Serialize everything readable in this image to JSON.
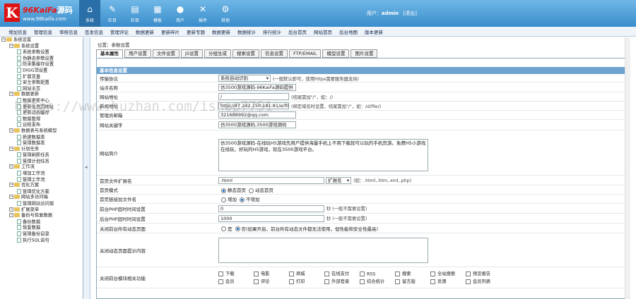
{
  "brand": {
    "logo_letter": "K",
    "name": "96KaiFa",
    "name_suffix": "源码",
    "url": "www.96kaifa.com"
  },
  "nav": [
    {
      "label": "系统",
      "icon": "home-icon"
    },
    {
      "label": "栏目",
      "icon": "document-edit-icon"
    },
    {
      "label": "栏目",
      "icon": "document-icon"
    },
    {
      "label": "模板",
      "icon": "template-icon"
    },
    {
      "label": "用户",
      "icon": "user-icon"
    },
    {
      "label": "插件",
      "icon": "tools-icon"
    },
    {
      "label": "其他",
      "icon": "gear-icon"
    }
  ],
  "user": {
    "prefix": "用户：",
    "name": "admin",
    "logout": "[退出]"
  },
  "menu": [
    "增加信息",
    "管理信息",
    "审核信息",
    "签发信息",
    "管理评论",
    "数据更新",
    "更新碎片",
    "更新专题",
    "数据更新",
    "数据统计",
    "排行统计",
    "后台首页",
    "网站首页",
    "后台地图",
    "版本更新"
  ],
  "tree": [
    {
      "t": "系统设置",
      "lvl": 0,
      "kind": "root"
    },
    {
      "t": "系统设置",
      "lvl": 1,
      "kind": "folder"
    },
    {
      "t": "系统参数设置",
      "lvl": 2,
      "kind": "doc"
    },
    {
      "t": "伪静态参数设置",
      "lvl": 2,
      "kind": "doc"
    },
    {
      "t": "防采集缓存设置",
      "lvl": 2,
      "kind": "doc"
    },
    {
      "t": "DIGG顶设置",
      "lvl": 2,
      "kind": "doc"
    },
    {
      "t": "扩展变量",
      "lvl": 2,
      "kind": "doc"
    },
    {
      "t": "安全参数配置",
      "lvl": 2,
      "kind": "doc"
    },
    {
      "t": "网站主页",
      "lvl": 2,
      "kind": "doc"
    },
    {
      "t": "数据更新",
      "lvl": 1,
      "kind": "folder"
    },
    {
      "t": "数据更新中心",
      "lvl": 2,
      "kind": "doc"
    },
    {
      "t": "更新信息页地址",
      "lvl": 2,
      "kind": "doc"
    },
    {
      "t": "更新动态缓存",
      "lvl": 2,
      "kind": "doc"
    },
    {
      "t": "数据整理",
      "lvl": 2,
      "kind": "doc"
    },
    {
      "t": "远程发布",
      "lvl": 2,
      "kind": "doc"
    },
    {
      "t": "数据表与系统模型",
      "lvl": 1,
      "kind": "folder"
    },
    {
      "t": "新建数据表",
      "lvl": 2,
      "kind": "doc"
    },
    {
      "t": "管理数据表",
      "lvl": 2,
      "kind": "doc"
    },
    {
      "t": "计划任务",
      "lvl": 1,
      "kind": "folder"
    },
    {
      "t": "管理刷新任务",
      "lvl": 2,
      "kind": "doc"
    },
    {
      "t": "管理计划任务",
      "lvl": 2,
      "kind": "doc"
    },
    {
      "t": "工作流",
      "lvl": 1,
      "kind": "folder"
    },
    {
      "t": "增加工作流",
      "lvl": 2,
      "kind": "doc"
    },
    {
      "t": "管理工作流",
      "lvl": 2,
      "kind": "doc"
    },
    {
      "t": "优化方案",
      "lvl": 1,
      "kind": "folder"
    },
    {
      "t": "管理优化方案",
      "lvl": 2,
      "kind": "doc"
    },
    {
      "t": "网站多访问端",
      "lvl": 1,
      "kind": "folder"
    },
    {
      "t": "管理网站访问端",
      "lvl": 2,
      "kind": "doc"
    },
    {
      "t": "扩展菜单",
      "lvl": 1,
      "kind": "folder"
    },
    {
      "t": "备份与恢复数据",
      "lvl": 1,
      "kind": "folder"
    },
    {
      "t": "备份数据",
      "lvl": 2,
      "kind": "doc"
    },
    {
      "t": "恢复数据",
      "lvl": 2,
      "kind": "doc"
    },
    {
      "t": "管理备份目录",
      "lvl": 2,
      "kind": "doc"
    },
    {
      "t": "执行SQL语句",
      "lvl": 2,
      "kind": "doc"
    }
  ],
  "crumb": "位置：参数设置",
  "tabs": [
    "基本属性",
    "用户设置",
    "文件设置",
    "JS设置",
    "分组生成",
    "搜索设置",
    "信息设置",
    "FTP/EMAIL",
    "模型设置",
    "图片设置"
  ],
  "section_title": "基本信息设置",
  "form": {
    "protocol_label": "传输协议",
    "protocol_value": "系统自动识别",
    "protocol_hint": "(一般默认即可，使用https需要服务器支持)",
    "sitename_label": "站点名称",
    "sitename_value": "仿3500游戏源码-96KaiFa源码提供",
    "siteurl_label": "网站地址",
    "siteurl_value": "/",
    "siteurl_hint": "(结尾需加\"/\"，如：/)",
    "newsurl_label": "新闻地址",
    "newsurl_value": "http://47.242.150.181:81/e/file/",
    "newsurl_hint": "(绑定域名时设置，结尾需加\"/\"，如：/d/file/)",
    "email_label": "管理员邮箱",
    "email_value": "321688992@qq.com",
    "keywords_label": "网站关键字",
    "keywords_value": "仿3500游戏源码,3500游戏源码",
    "desc_label": "网站简介",
    "desc_value": "仿3500游戏源码-在线玩H5游戏先用户提供海量手机上不用下载就可以玩的手机页游。免费H5小游戏在线玩，好玩的H5游戏，就在3500游戏平台。",
    "ext_label": "首页文件扩展名",
    "ext_value": ".html",
    "ext_select": "扩展名",
    "ext_hint": "(如：.html,.htm,.xml,.php)",
    "mode_label": "首页模式",
    "mode_opt1": "静态首页",
    "mode_opt2": "动态首页",
    "random_label": "首页链接加文件名",
    "random_opt1": "增加",
    "random_opt2": "不增加",
    "php_front_label": "前台PHP超时时间设置",
    "php_front_value": "0",
    "php_front_hint": "秒 (一般不需要设置)",
    "php_back_label": "后台PHP超时时间设置",
    "php_back_value": "1000",
    "php_back_hint": "秒 (一般不需要设置)",
    "close_label": "关闭前台所有动态页面",
    "close_opt1": "是",
    "close_opt2": "否(如果开启，前台所有动态文件都无法使用，但性能和安全性最高)",
    "close_tip_label": "关闭动态页面提示内容",
    "modules_label": "关闭前台模块相关功能",
    "modules_row1": [
      "下载",
      "电影",
      "商城",
      "在线支付",
      "RSS",
      "搜索",
      "全站搜索",
      "预览报告"
    ],
    "modules_row2": [
      "会员",
      "评论",
      "打印",
      "外部登录",
      "综合统计",
      "留言版",
      "反馈",
      "会员列表"
    ]
  },
  "watermark": "https://www.huzhan.com/ishop7751"
}
